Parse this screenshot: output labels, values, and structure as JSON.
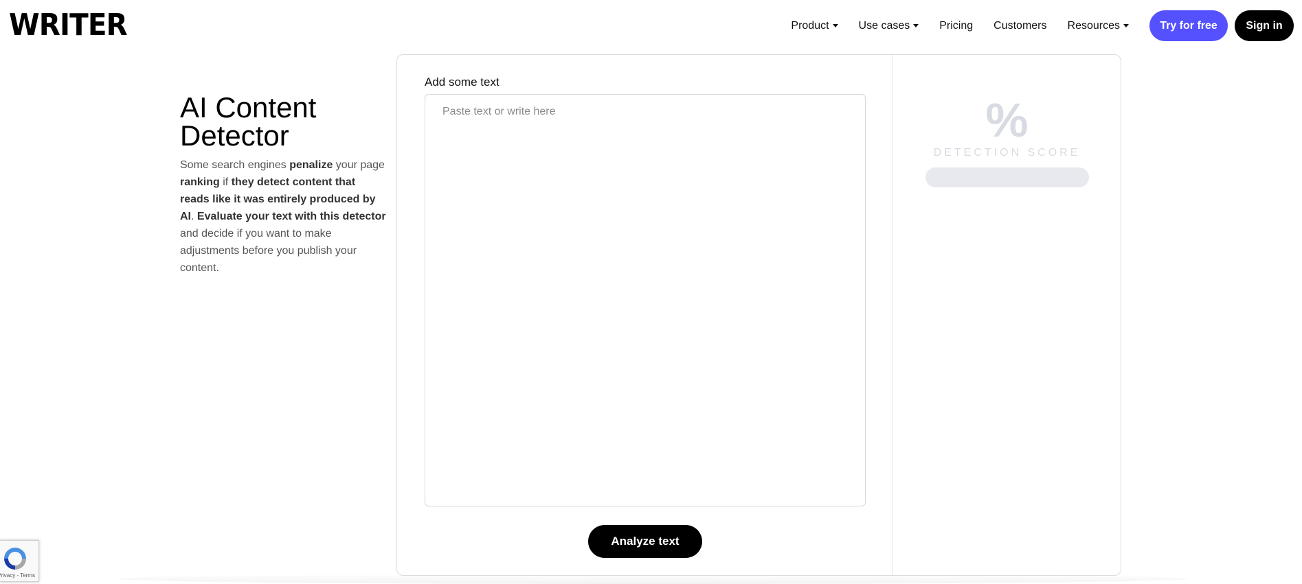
{
  "header": {
    "logo": "WRITER",
    "nav": [
      {
        "label": "Product",
        "has_dropdown": true
      },
      {
        "label": "Use cases",
        "has_dropdown": true
      },
      {
        "label": "Pricing",
        "has_dropdown": false
      },
      {
        "label": "Customers",
        "has_dropdown": false
      },
      {
        "label": "Resources",
        "has_dropdown": true
      }
    ],
    "try_label": "Try for free",
    "signin_label": "Sign in"
  },
  "intro": {
    "title": "AI Content Detector",
    "desc_parts": [
      "Some search engines ",
      "penalize",
      " your page ",
      "ranking",
      " if ",
      "they detect content that reads like it was entirely produced by AI",
      ". ",
      "Evaluate your text with this detector",
      " and decide if you want to make adjustments before you publish your content."
    ]
  },
  "tool": {
    "input_label": "Add some text",
    "placeholder": "Paste text or write here",
    "analyze_label": "Analyze text",
    "score_symbol": "%",
    "score_label": "DETECTION SCORE",
    "score_value": 0
  },
  "recaptcha": {
    "legal": "Privacy - Terms"
  },
  "colors": {
    "accent": "#5551ff",
    "black": "#000000",
    "muted": "#d9dbe2"
  }
}
